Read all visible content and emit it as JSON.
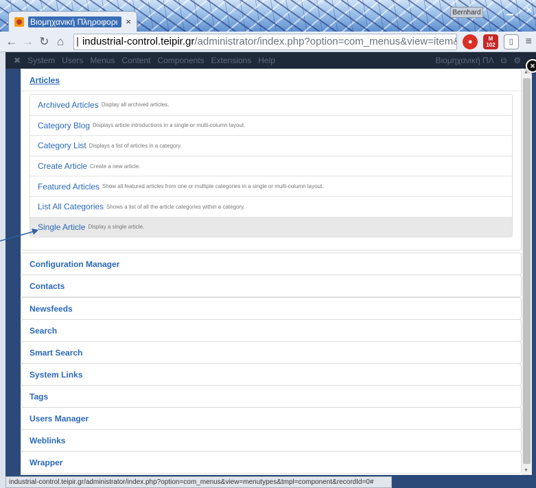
{
  "browser": {
    "tab_title": "Βιομηχανική Πληροφορι",
    "tab_close": "×",
    "user_label": "Bernhard",
    "url_host": "industrial-control.teipir.gr",
    "url_path": "/administrator/index.php?option=com_menus&view=item&lay",
    "mail_count": "102",
    "icons": [
      "back-icon",
      "forward-icon",
      "reload-icon",
      "home-icon",
      "star-icon",
      "menu-icon"
    ]
  },
  "admin_bar": {
    "items": [
      "System",
      "Users",
      "Menus",
      "Content",
      "Components",
      "Extensions",
      "Help"
    ],
    "site_name": "Βιομηχανική ΠΛ"
  },
  "modal": {
    "close_glyph": "×",
    "open_section": {
      "title": "Articles",
      "items": [
        {
          "title": "Archived Articles",
          "desc": "Display all archived articles."
        },
        {
          "title": "Category Blog",
          "desc": "Displays article introductions in a single or multi-column layout."
        },
        {
          "title": "Category List",
          "desc": "Displays a list of articles in a category."
        },
        {
          "title": "Create Article",
          "desc": "Create a new article."
        },
        {
          "title": "Featured Articles",
          "desc": "Show all featured articles from one or multiple categories in a single or multi-column layout."
        },
        {
          "title": "List All Categories",
          "desc": "Shows a list of all the article categories within a category."
        },
        {
          "title": "Single Article",
          "desc": "Display a single article."
        }
      ],
      "active_index": 6
    },
    "sections": [
      "Configuration Manager",
      "Contacts",
      "Newsfeeds",
      "Search",
      "Smart Search",
      "System Links",
      "Tags",
      "Users Manager",
      "Weblinks",
      "Wrapper"
    ]
  },
  "status_bar": {
    "text": "industrial-control.teipir.gr/administrator/index.php?option=com_menus&view=menutypes&tmpl=component&recordId=0#"
  },
  "colors": {
    "link": "#2a69b8",
    "admin_bar": "#1e2a3a",
    "active_row": "#e8e8e8"
  }
}
